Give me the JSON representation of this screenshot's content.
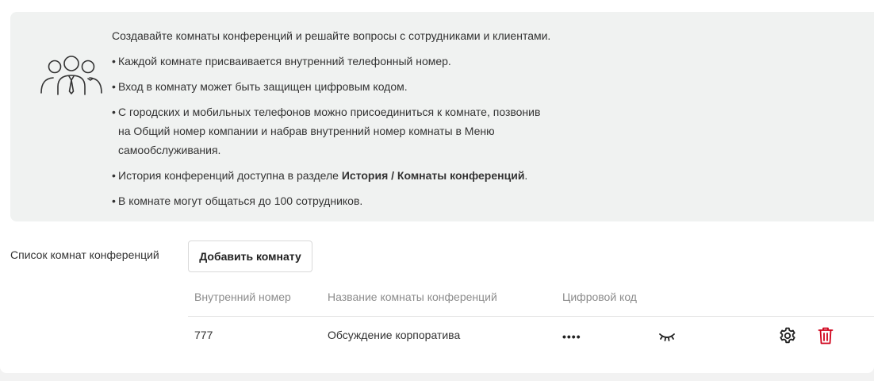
{
  "info": {
    "intro": "Создавайте комнаты конференций и решайте вопросы с сотрудниками и клиентами.",
    "bullets": [
      "Каждой комнате присваивается внутренний телефонный номер.",
      "Вход в комнату может быть защищен цифровым кодом.",
      "С городских и мобильных телефонов можно присоединиться к комнате, позвонив",
      "на Общий номер компании и набрав внутренний номер комнаты в Меню",
      "самообслуживания."
    ],
    "history_prefix": "История конференций доступна в разделе ",
    "history_link": "История / Комнаты конференций",
    "history_suffix": ".",
    "limit": "В комнате могут общаться до 100 сотрудников.",
    "bullet_char": "•",
    "icon": "people-group-icon"
  },
  "list": {
    "label": "Список комнат конференций",
    "add_button": "Добавить комнату"
  },
  "table": {
    "headers": [
      "Внутренний номер",
      "Название комнаты конференций",
      "Цифровой код"
    ],
    "rows": [
      {
        "number": "777",
        "name": "Обсуждение корпоратива",
        "code_masked": "••••"
      }
    ]
  },
  "colors": {
    "delete": "#d0021b",
    "panel": "#f0f2f1"
  }
}
